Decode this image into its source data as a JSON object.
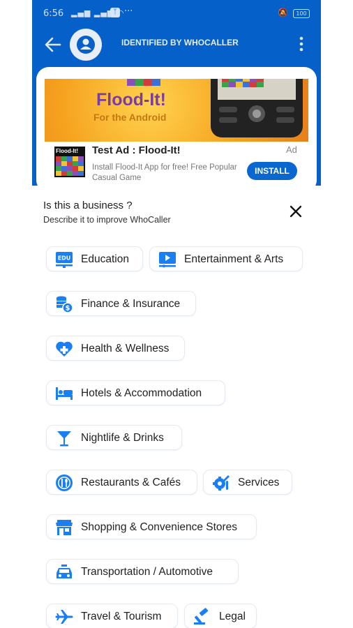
{
  "status_bar": {
    "time": "6:56",
    "battery": "100"
  },
  "header": {
    "title": "IDENTIFIED BY WHOCALLER"
  },
  "ad": {
    "banner_title": "Flood-It!",
    "banner_subtitle": "For the Android",
    "thumb_label": "Flood-It!",
    "title": "Test Ad : Flood-It!",
    "tag": "Ad",
    "description": "Install Flood-It App for free! Free Popular Casual Game",
    "install_label": "INSTALL"
  },
  "sheet": {
    "title": "Is this a business ?",
    "subtitle": "Describe it to improve WhoCaller"
  },
  "categories": [
    {
      "label": "Education",
      "icon": "edu-icon"
    },
    {
      "label": "Entertainment & Arts",
      "icon": "play-icon"
    },
    {
      "label": "Finance & Insurance",
      "icon": "coins-icon"
    },
    {
      "label": "Health & Wellness",
      "icon": "heart-plus-icon"
    },
    {
      "label": "Hotels & Accommodation",
      "icon": "bed-icon"
    },
    {
      "label": "Nightlife & Drinks",
      "icon": "cocktail-icon"
    },
    {
      "label": "Restaurants & Cafés",
      "icon": "utensils-icon"
    },
    {
      "label": "Services",
      "icon": "tools-icon"
    },
    {
      "label": "Shopping & Convenience Stores",
      "icon": "store-icon"
    },
    {
      "label": "Transportation / Automotive",
      "icon": "taxi-icon"
    },
    {
      "label": "Travel & Tourism",
      "icon": "airplane-icon"
    },
    {
      "label": "Legal",
      "icon": "gavel-icon"
    }
  ],
  "colors": {
    "brand": "#0561c9",
    "icon": "#1a7ff2"
  }
}
